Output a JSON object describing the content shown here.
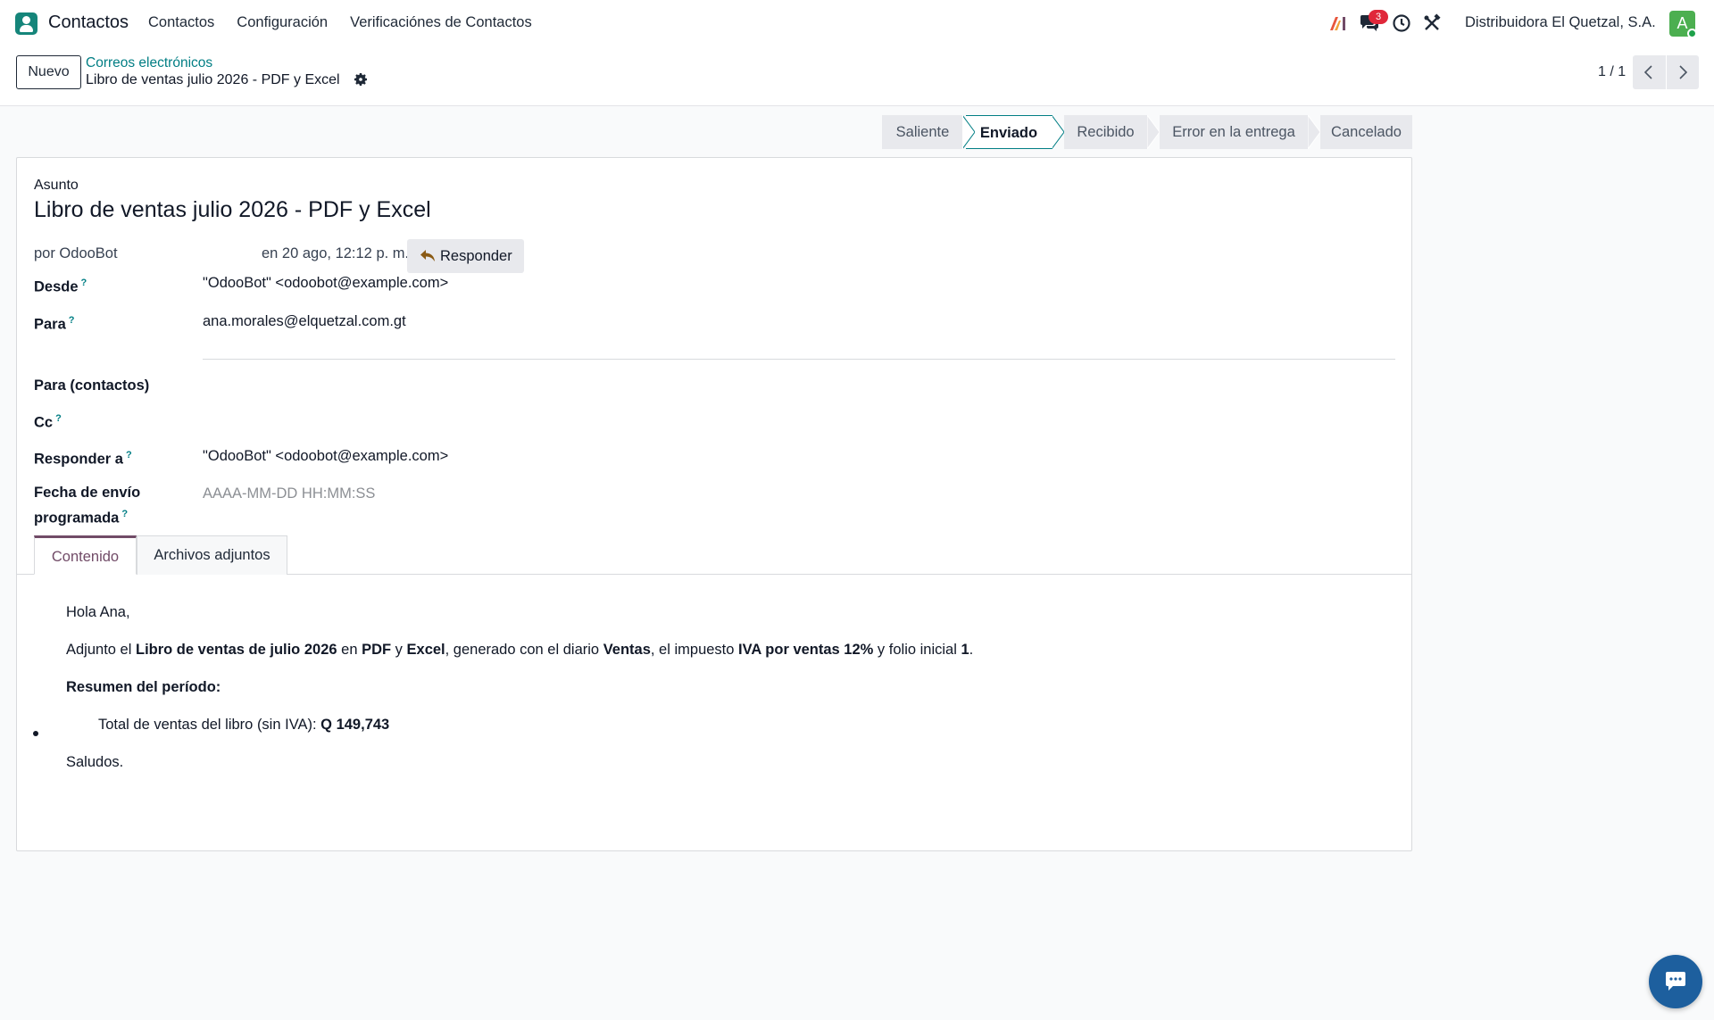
{
  "navbar": {
    "app_name": "Contactos",
    "menu": [
      "Contactos",
      "Configuración",
      "Verificaciónes de Contactos"
    ],
    "messages_badge": "3",
    "company": "Distribuidora El Quetzal, S.A.",
    "avatar_letter": "A"
  },
  "control": {
    "new_label": "Nuevo",
    "breadcrumb_parent": "Correos electrónicos",
    "breadcrumb_current": "Libro de ventas julio 2026 - PDF y Excel",
    "pager": "1 / 1"
  },
  "statusbar": {
    "stages": [
      "Saliente",
      "Enviado",
      "Recibido",
      "Error en la entrega",
      "Cancelado"
    ],
    "active": "Enviado"
  },
  "form": {
    "subject_label": "Asunto",
    "subject": "Libro de ventas julio 2026 - PDF y Excel",
    "author": "por OdooBot",
    "date": "en 20 ago, 12:12 p. m.",
    "reply_label": "Responder",
    "fields": {
      "from_label": "Desde",
      "from_value": "\"OdooBot\" <odoobot@example.com>",
      "to_label": "Para",
      "to_value": "ana.morales@elquetzal.com.gt",
      "to_partners_label": "Para (contactos)",
      "cc_label": "Cc",
      "reply_to_label": "Responder a",
      "reply_to_value": "\"OdooBot\" <odoobot@example.com>",
      "scheduled_label_1": "Fecha de envío",
      "scheduled_label_2": "programada",
      "scheduled_placeholder": "AAAA-MM-DD HH:MM:SS"
    },
    "help_mark": "?",
    "tabs": [
      "Contenido",
      "Archivos adjuntos"
    ],
    "body": {
      "greeting": "Hola Ana,",
      "line_pre": "Adjunto el ",
      "book": "Libro de ventas de julio 2026",
      "en": " en ",
      "pdf": "PDF",
      "y": " y ",
      "excel": "Excel",
      "generated": ", generado con el diario ",
      "journal": "Ventas",
      "tax_pre": ", el impuesto ",
      "tax": "IVA por ventas 12%",
      "folio_pre": " y folio inicial ",
      "folio": "1",
      "period": ".",
      "summary_title": "Resumen del período:",
      "total_label": "Total de ventas del libro (sin IVA): ",
      "total_value": "Q 149,743",
      "closing": "Saludos."
    }
  },
  "colors": {
    "accent_teal": "#017e84",
    "tab_purple": "#714b67",
    "badge_red": "#e0273a",
    "avatar_green": "#4caf50",
    "fab_blue": "#1d5f9e"
  },
  "icons": [
    "contacts-app-icon",
    "ai-icon",
    "chat-icon",
    "clock-icon",
    "tools-icon",
    "gear-icon",
    "chevron-left-icon",
    "chevron-right-icon",
    "reply-icon",
    "livechat-icon"
  ]
}
